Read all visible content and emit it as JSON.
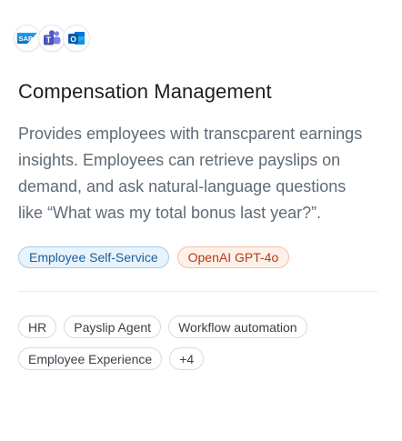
{
  "card": {
    "logos": [
      {
        "name": "sap-logo",
        "text": "SAP",
        "color": "#0a7fd1"
      },
      {
        "name": "teams-logo",
        "text": "T",
        "color": "#5059c9"
      },
      {
        "name": "outlook-logo",
        "text": "O",
        "color": "#0b64c2"
      }
    ],
    "title": "Compensation Management",
    "description": "Provides employees with transcparent earnings insights. Employees can retrieve payslips on demand, and ask natural-language questions like “What was my total bonus last year?”.",
    "primary_tags": [
      {
        "label": "Employee Self-Service",
        "style": "blue"
      },
      {
        "label": "OpenAI GPT-4o",
        "style": "orange"
      }
    ],
    "keyword_tags": [
      "HR",
      "Payslip Agent",
      "Workflow automation",
      "Employee Experience",
      "+4"
    ]
  },
  "colors": {
    "blue_tag_bg": "#e8f3fc",
    "blue_tag_text": "#1c5f9c",
    "orange_tag_bg": "#fdf0e8",
    "orange_tag_text": "#b23d14",
    "description_text": "#5f6b76"
  }
}
